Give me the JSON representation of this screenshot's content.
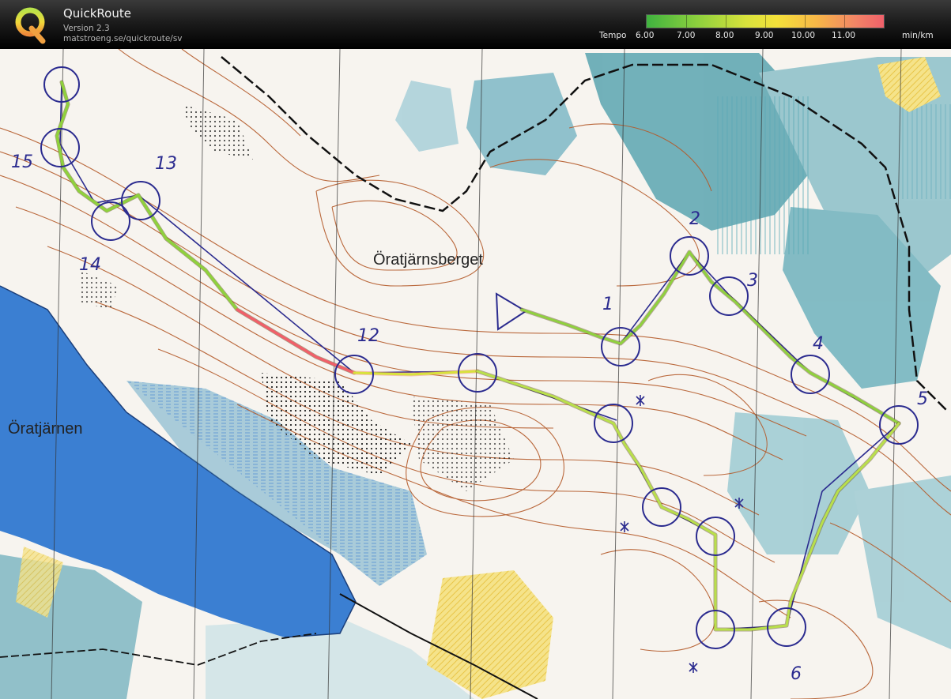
{
  "app": {
    "title": "QuickRoute",
    "version": "Version 2.3",
    "url": "matstroeng.se/quickroute/sv",
    "logo_letter": "Q"
  },
  "legend": {
    "label": "Tempo",
    "ticks": [
      "6.00",
      "7.00",
      "8.00",
      "9.00",
      "10.00",
      "11.00"
    ],
    "unit": "min/km",
    "colors": [
      "#3fb23f",
      "#8fd13d",
      "#d8e23c",
      "#f4e13a",
      "#f7b648",
      "#f28566",
      "#f0606a"
    ]
  },
  "map": {
    "place_labels": [
      "Öratjärnsberget",
      "Öratjärnen"
    ],
    "control_numbers": [
      "1",
      "2",
      "3",
      "4",
      "5",
      "6",
      "12",
      "13",
      "14",
      "15"
    ],
    "colors": {
      "water": "#3b7fd2",
      "marsh": "#58a9c9",
      "contour": "#b45a2a",
      "route": "#8fd13d",
      "course": "#2b2b8f",
      "open_land": "#f2d33a"
    }
  }
}
